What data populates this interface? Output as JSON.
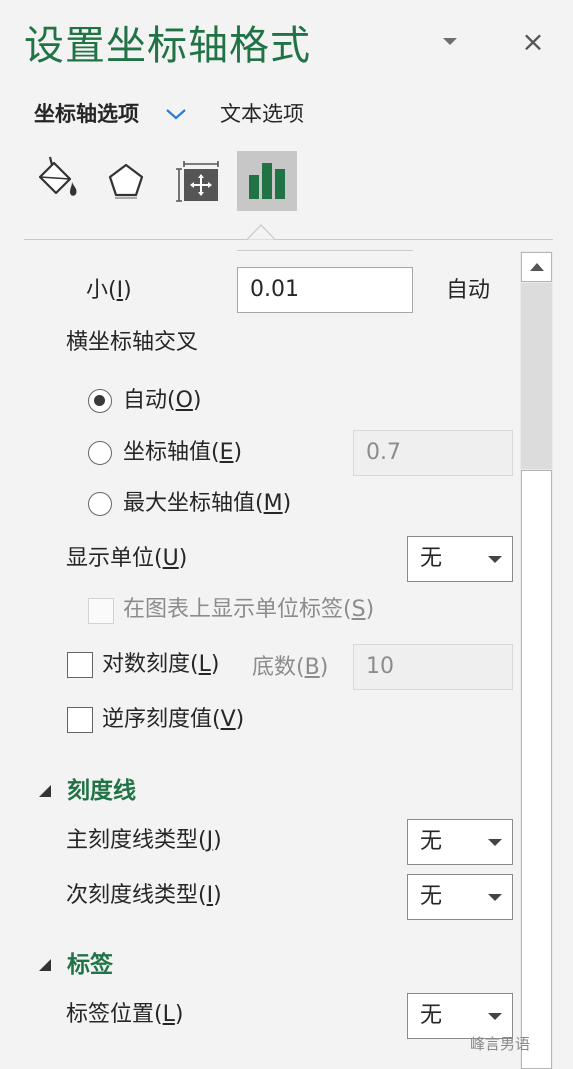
{
  "pane": {
    "title": "设置坐标轴格式",
    "tabs": {
      "axis_options": "坐标轴选项",
      "text_options": "文本选项"
    }
  },
  "icons": {
    "pane_menu": "chevron-down-icon",
    "close": "close-icon",
    "close_glyph": "×",
    "fill_line": "paint-bucket-icon",
    "effects": "pentagon-icon",
    "size_properties": "size-properties-icon",
    "axis_options": "bar-chart-icon"
  },
  "colors": {
    "accent": "#217346",
    "selected_tab_bg": "#c7c7c7"
  },
  "minor_unit": {
    "label_prefix": "小(",
    "label_key": "I",
    "label_suffix": ")",
    "value": "0.01",
    "auto": "自动"
  },
  "cross": {
    "heading": "横坐标轴交叉",
    "options": [
      {
        "prefix": "自动(",
        "key": "O",
        "suffix": ")",
        "selected": true
      },
      {
        "prefix": "坐标轴值(",
        "key": "E",
        "suffix": ")",
        "selected": false,
        "value": "0.7"
      },
      {
        "prefix": "最大坐标轴值(",
        "key": "M",
        "suffix": ")",
        "selected": false
      }
    ]
  },
  "display_units": {
    "prefix": "显示单位(",
    "key": "U",
    "suffix": ")",
    "value": "无",
    "show_label": {
      "prefix": "在图表上显示单位标签(",
      "key": "S",
      "suffix": ")"
    }
  },
  "log_scale": {
    "prefix": "对数刻度(",
    "key": "L",
    "suffix": ")",
    "base_prefix": "底数(",
    "base_key": "B",
    "base_suffix": ")",
    "base_value": "10"
  },
  "reverse": {
    "prefix": "逆序刻度值(",
    "key": "V",
    "suffix": ")"
  },
  "tick_marks": {
    "title": "刻度线",
    "major": {
      "prefix": "主刻度线类型(",
      "key": "J",
      "suffix": ")",
      "value": "无"
    },
    "minor": {
      "prefix": "次刻度线类型(",
      "key": "I",
      "suffix": ")",
      "value": "无"
    }
  },
  "labels": {
    "title": "标签",
    "position": {
      "prefix": "标签位置(",
      "key": "L",
      "suffix": ")",
      "value": "无"
    }
  },
  "watermark": "峰言男语"
}
